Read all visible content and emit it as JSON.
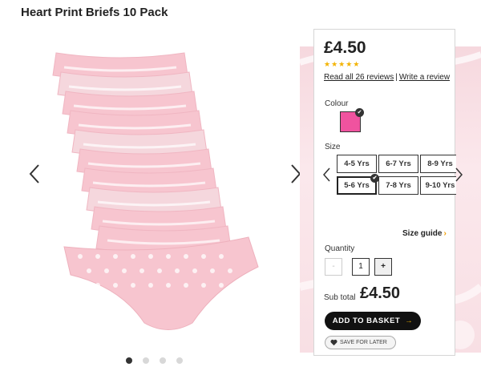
{
  "product": {
    "title": "Heart Print Briefs 10 Pack",
    "price": "£4.50",
    "rating": 5,
    "star_glyph": "★",
    "reviews_link": "Read all 26 reviews",
    "separator": "|",
    "write_review": "Write a review"
  },
  "gallery": {
    "image_count": 4,
    "active_index": 0,
    "prev_icon": "chevron-left-icon",
    "next_icon": "chevron-right-icon"
  },
  "colour": {
    "label": "Colour",
    "selected_hex": "#f0539f",
    "check_glyph": "✔"
  },
  "size": {
    "label": "Size",
    "options": [
      "4-5 Yrs",
      "6-7 Yrs",
      "8-9 Yrs",
      "5-6 Yrs",
      "7-8 Yrs",
      "9-10 Yrs"
    ],
    "selected": "5-6 Yrs",
    "guide_label": "Size guide",
    "guide_arrow": "›"
  },
  "quantity": {
    "label": "Quantity",
    "minus": "-",
    "value": "1",
    "plus": "+"
  },
  "subtotal": {
    "label": "Sub total",
    "value": "£4.50"
  },
  "actions": {
    "add_to_basket": "ADD TO BASKET",
    "add_arrow": "→",
    "save_for_later": "SAVE FOR LATER"
  },
  "colors": {
    "accent": "#f3b300",
    "product_pink": "#f7c5cf",
    "swatch": "#f0539f"
  }
}
